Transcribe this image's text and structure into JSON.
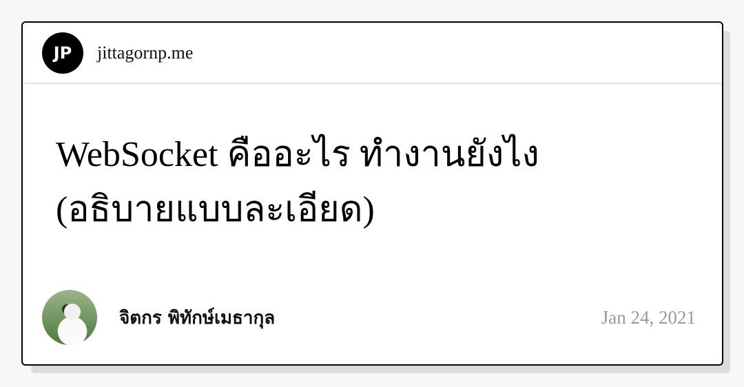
{
  "site": {
    "logo_text": "JP",
    "name": "jittagornp.me"
  },
  "article": {
    "title_line1": "WebSocket คืออะไร ทำงานยังไง",
    "title_line2": "(อธิบายแบบละเอียด)"
  },
  "author": {
    "name": "จิตกร พิทักษ์เมธากุล"
  },
  "date": "Jan 24, 2021"
}
